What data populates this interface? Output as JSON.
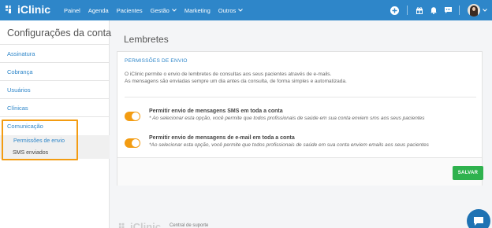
{
  "app": {
    "logo_text": "iClinic",
    "brand_color": "#2e86c9",
    "accent_color": "#f39c12",
    "success_color": "#2fb24e"
  },
  "nav": {
    "items": [
      {
        "label": "Painel",
        "has_dropdown": false
      },
      {
        "label": "Agenda",
        "has_dropdown": false
      },
      {
        "label": "Pacientes",
        "has_dropdown": false
      },
      {
        "label": "Gestão",
        "has_dropdown": true
      },
      {
        "label": "Marketing",
        "has_dropdown": false
      },
      {
        "label": "Outros",
        "has_dropdown": true
      }
    ],
    "right_icons": [
      "plus-circle-icon",
      "gift-icon",
      "bell-icon",
      "chat-icon",
      "avatar"
    ]
  },
  "sidebar": {
    "title": "Configurações da conta",
    "items": [
      {
        "label": "Assinatura"
      },
      {
        "label": "Cobrança"
      },
      {
        "label": "Usuários"
      },
      {
        "label": "Clínicas"
      },
      {
        "label": "Comunicação"
      }
    ],
    "sub_items": [
      {
        "label": "Permissões de envio",
        "active": true
      },
      {
        "label": "SMS enviados",
        "active": false
      }
    ]
  },
  "main": {
    "page_title": "Lembretes",
    "card": {
      "header": "PERMISSÕES DE ENVIO",
      "description_1": "O iClinic permite o envio de lembretes de consultas aos seus pacientes através de e-mails.",
      "description_2": "As mensagens são enviadas sempre um dia antes da consulta, de forma simples e automatizada.",
      "options": [
        {
          "title": "Permitir envio de mensagens SMS em toda a conta",
          "note": "* Ao selecionar esta opção, você permite que todos profissionais de saúde em sua conta enviem sms aos seus pacientes",
          "enabled": true
        },
        {
          "title": "Permitir envio de mensagens de e-mail em toda a conta",
          "note": "*Ao selecionar esta opção, você permite que todos profissionais de saúde em sua conta enviem emails aos seus pacientes",
          "enabled": true
        }
      ],
      "save_label": "SALVAR"
    }
  },
  "footer": {
    "logo_text": "iClinic",
    "link": "Central de suporte"
  }
}
